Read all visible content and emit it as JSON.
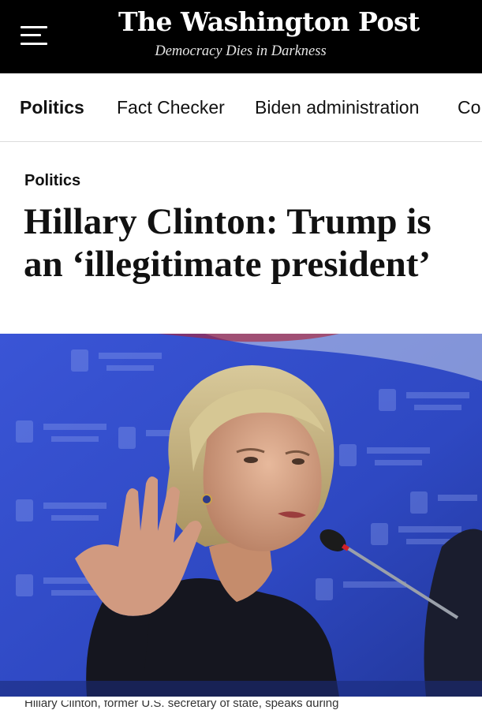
{
  "masthead": {
    "logo": "The Washington Post",
    "tagline": "Democracy Dies in Darkness",
    "menu_icon": "hamburger-menu-icon"
  },
  "nav": {
    "items": [
      {
        "label": "Politics",
        "active": true
      },
      {
        "label": "Fact Checker",
        "active": false
      },
      {
        "label": "Biden administration",
        "active": false
      },
      {
        "label": "Co",
        "active": false
      }
    ]
  },
  "article": {
    "kicker": "Politics",
    "headline": "Hillary Clinton: Trump is an ‘illegitimate president’",
    "caption": "Hillary Clinton, former U.S. secretary of state, speaks during"
  },
  "photo": {
    "subject": "hillary-clinton-photo",
    "backdrop_color": "#2f4fc8"
  }
}
